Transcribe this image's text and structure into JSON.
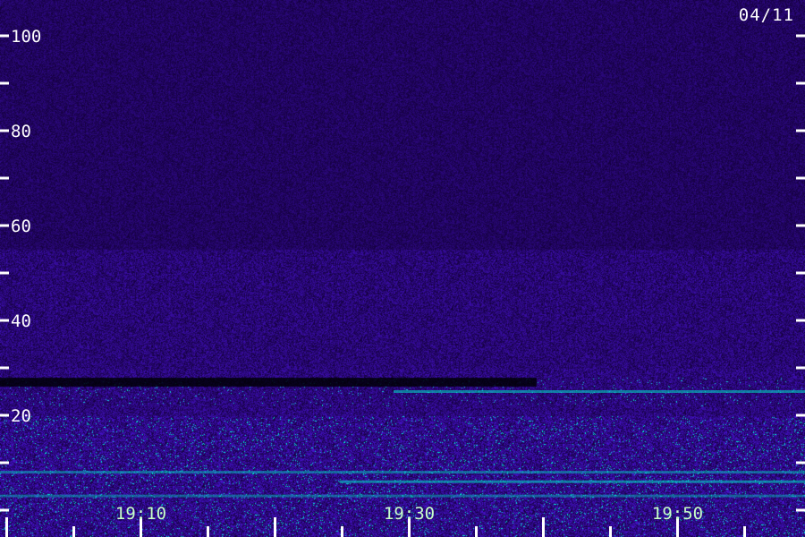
{
  "date_label": "04/11",
  "chart_data": {
    "type": "heatmap",
    "title": "",
    "xlabel": "",
    "ylabel": "",
    "x_tick_labels": [
      "19:10",
      "19:30",
      "19:50"
    ],
    "x_ticks_minutes_after_1900": [
      10,
      30,
      50
    ],
    "xlim_minutes_after_1900": [
      -0.5,
      59.5
    ],
    "y_tick_labels": [
      "20",
      "40",
      "60",
      "80",
      "100"
    ],
    "y_tick_values": [
      20,
      40,
      60,
      80,
      100
    ],
    "ylim": [
      0,
      100
    ],
    "grid": false,
    "colors": {
      "background": "#0a0033",
      "noise": "#3a18c8",
      "band": "#2f3cff",
      "strong": "#00e0c8",
      "dark_gap": "#000000",
      "tick": "#ffffff"
    }
  }
}
